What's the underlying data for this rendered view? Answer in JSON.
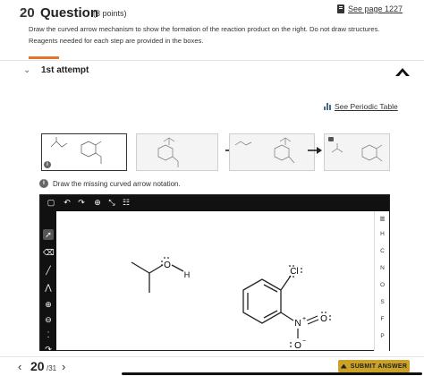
{
  "question": {
    "number": "20",
    "word": "Question",
    "points": "(3 points)",
    "see_page": "See page 1227",
    "text": "Draw the curved arrow mechanism to show the formation of the reaction product on the right. Do not draw structures. Reagents needed for each step are provided in the boxes."
  },
  "attempt": {
    "label": "1st attempt"
  },
  "periodic_table": "See Periodic Table",
  "instruction": "Draw the missing curved arrow notation.",
  "editor": {
    "right_panel": [
      "H",
      "C",
      "N",
      "O",
      "S",
      "F",
      "P"
    ],
    "molecules": {
      "alcohol_h": "H",
      "alcohol_o": "O",
      "chloro": "Cl",
      "nitro_n": "N",
      "nitro_o_top": "O",
      "nitro_o_bottom": "O",
      "plus": "+",
      "minus": "−"
    }
  },
  "footer": {
    "page": "20",
    "total": "/31",
    "submit": "SUBMIT ANSWER"
  },
  "colors": {
    "accent": "#e8742a",
    "submit": "#c9a227",
    "toolbar": "#111111"
  }
}
